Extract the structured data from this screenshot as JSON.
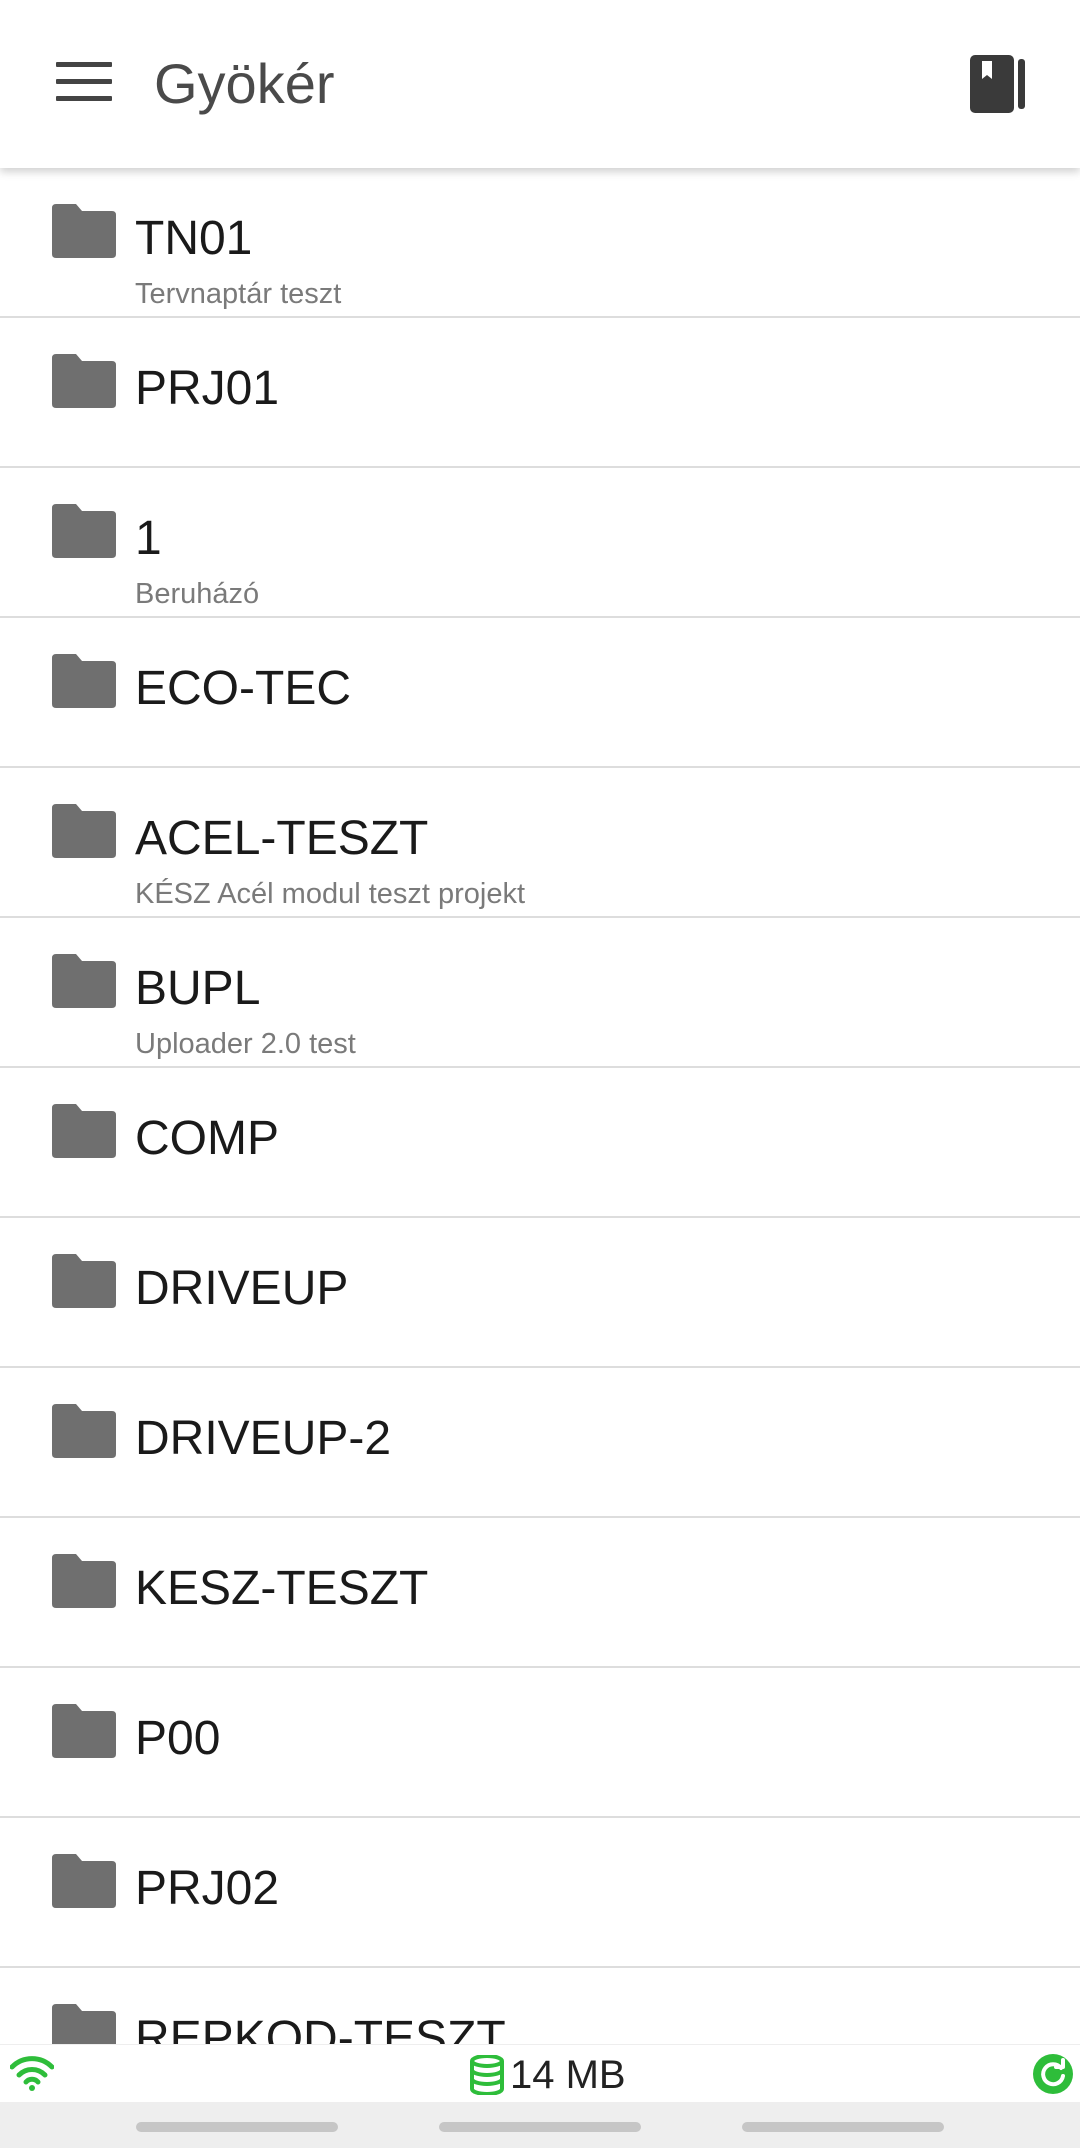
{
  "header": {
    "title": "Gyökér",
    "menu_icon": "hamburger-menu-icon",
    "action_icon": "book-icon"
  },
  "folders": [
    {
      "name": "TN01",
      "description": "Tervnaptár teszt"
    },
    {
      "name": "PRJ01",
      "description": ""
    },
    {
      "name": "1",
      "description": "Beruházó"
    },
    {
      "name": "ECO-TEC",
      "description": ""
    },
    {
      "name": "ACEL-TESZT",
      "description": "KÉSZ Acél modul teszt projekt"
    },
    {
      "name": "BUPL",
      "description": "Uploader 2.0 test"
    },
    {
      "name": "COMP",
      "description": ""
    },
    {
      "name": "DRIVEUP",
      "description": ""
    },
    {
      "name": "DRIVEUP-2",
      "description": ""
    },
    {
      "name": "KESZ-TESZT",
      "description": ""
    },
    {
      "name": "P00",
      "description": ""
    },
    {
      "name": "PRJ02",
      "description": ""
    },
    {
      "name": "REPKOD-TESZT",
      "description": ""
    }
  ],
  "status": {
    "storage": "14 MB",
    "wifi_icon": "wifi-icon",
    "storage_icon": "database-icon",
    "sync_icon": "sync-icon"
  },
  "colors": {
    "folder_icon": "#6f6f6f",
    "status_green": "#2ebd3a",
    "title_text": "#4a4a4a",
    "divider": "#dddddd"
  }
}
